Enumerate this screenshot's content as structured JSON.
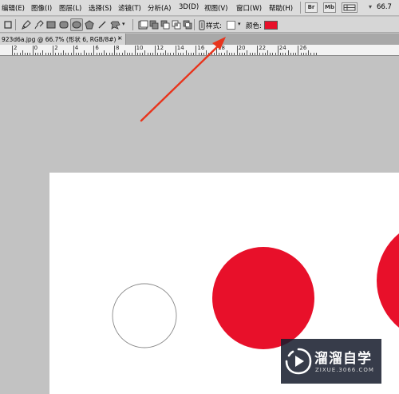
{
  "menu": {
    "items": [
      "编辑(E)",
      "图像(I)",
      "图层(L)",
      "选择(S)",
      "滤镜(T)",
      "分析(A)",
      "3D(D)",
      "视图(V)",
      "窗口(W)",
      "帮助(H)"
    ],
    "br_label": "Br",
    "mb_label": "Mb",
    "zoom": "66.7"
  },
  "options": {
    "style_label": "样式:",
    "color_label": "颜色:",
    "color_value": "#e8102a"
  },
  "document": {
    "tab_title": "923d6a.jpg @ 66.7% (形状 6, RGB/8#) *",
    "close_label": "×"
  },
  "ruler": {
    "labels": [
      "2",
      "0",
      "2",
      "4",
      "6",
      "8",
      "10",
      "12",
      "14",
      "16",
      "18",
      "20",
      "22",
      "24",
      "26"
    ]
  },
  "canvas": {
    "background": "#ffffff",
    "shape_fill": "#e8102a",
    "outline_color": "#8a8a8a"
  },
  "annotation": {
    "arrow_color": "#e8341c"
  },
  "watermark": {
    "title": "溜溜自学",
    "subtitle": "ZIXUE.3066.COM"
  }
}
